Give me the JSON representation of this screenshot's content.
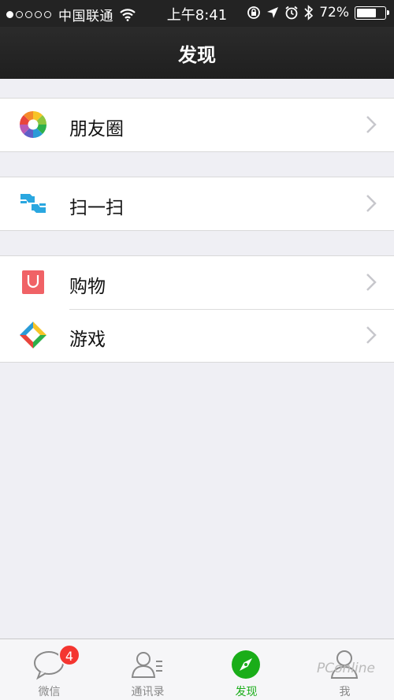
{
  "status_bar": {
    "carrier": "中国联通",
    "time": "上午8:41",
    "battery_percent": "72%",
    "battery_level": 0.72,
    "signal_bars_filled": 1,
    "signal_bars_total": 5,
    "icons": [
      "wifi-icon",
      "rotation-lock-icon",
      "location-arrow-icon",
      "alarm-icon",
      "bluetooth-icon",
      "battery-icon"
    ]
  },
  "nav": {
    "title": "发现"
  },
  "groups": [
    {
      "items": [
        {
          "label": "朋友圈",
          "icon": "moments-icon"
        }
      ]
    },
    {
      "items": [
        {
          "label": "扫一扫",
          "icon": "scan-icon"
        }
      ]
    },
    {
      "items": [
        {
          "label": "购物",
          "icon": "shopping-icon"
        },
        {
          "label": "游戏",
          "icon": "games-icon"
        }
      ]
    }
  ],
  "tabbar": {
    "tabs": [
      {
        "label": "微信",
        "icon": "chat-bubble-icon",
        "badge": "4",
        "active": false
      },
      {
        "label": "通讯录",
        "icon": "contacts-icon",
        "active": false
      },
      {
        "label": "发现",
        "icon": "compass-icon",
        "active": true
      },
      {
        "label": "我",
        "icon": "person-icon",
        "active": false
      }
    ]
  },
  "watermark": {
    "text": "PConline"
  },
  "colors": {
    "accent_green": "#1aad19",
    "badge_red": "#f43530",
    "nav_bg": "#232323",
    "page_bg": "#efeff4"
  }
}
